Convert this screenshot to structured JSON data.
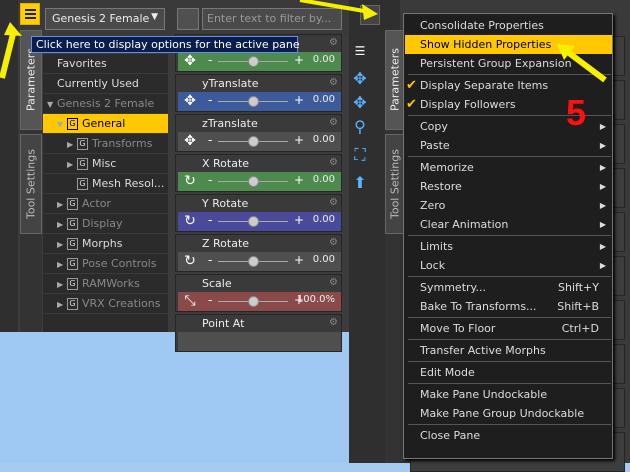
{
  "left_panel": {
    "figure_selector": "Genesis 2 Female",
    "search_placeholder": "Enter text to filter by...",
    "tooltip": "Click here to display options for the active pane",
    "vtabs": [
      "Parameters",
      "Tool Settings"
    ],
    "tree": [
      {
        "label": "Favorites",
        "level": 0,
        "dim": false,
        "sel": false,
        "box": false,
        "arrow": ""
      },
      {
        "label": "Currently Used",
        "level": 0,
        "dim": false,
        "sel": false,
        "box": false,
        "arrow": ""
      },
      {
        "label": "Genesis 2 Female",
        "level": 0,
        "dim": true,
        "sel": false,
        "box": false,
        "arrow": "▼"
      },
      {
        "label": "General",
        "level": 1,
        "dim": false,
        "sel": true,
        "box": true,
        "arrow": "▼"
      },
      {
        "label": "Transforms",
        "level": 2,
        "dim": true,
        "sel": false,
        "box": true,
        "arrow": "▶"
      },
      {
        "label": "Misc",
        "level": 2,
        "dim": false,
        "sel": false,
        "box": true,
        "arrow": "▶"
      },
      {
        "label": "Mesh Resol...",
        "level": 2,
        "dim": false,
        "sel": false,
        "box": true,
        "arrow": ""
      },
      {
        "label": "Actor",
        "level": 1,
        "dim": true,
        "sel": false,
        "box": true,
        "arrow": "▶"
      },
      {
        "label": "Display",
        "level": 1,
        "dim": true,
        "sel": false,
        "box": true,
        "arrow": "▶"
      },
      {
        "label": "Morphs",
        "level": 1,
        "dim": false,
        "sel": false,
        "box": true,
        "arrow": "▶"
      },
      {
        "label": "Pose Controls",
        "level": 1,
        "dim": true,
        "sel": false,
        "box": true,
        "arrow": "▶"
      },
      {
        "label": "RAMWorks",
        "level": 1,
        "dim": true,
        "sel": false,
        "box": true,
        "arrow": "▶"
      },
      {
        "label": "VRX Creations",
        "level": 1,
        "dim": true,
        "sel": false,
        "box": true,
        "arrow": "▶"
      }
    ],
    "params": [
      {
        "name": "",
        "value": "0.00",
        "color": "#4d8a4d",
        "icon": "✥"
      },
      {
        "name": "yTranslate",
        "value": "0.00",
        "color": "#3d5a9a",
        "icon": "✥"
      },
      {
        "name": "zTranslate",
        "value": "0.00",
        "color": "#4f4f4f",
        "icon": "✥"
      },
      {
        "name": "X Rotate",
        "value": "0.00",
        "color": "#4d8a4d",
        "icon": "↻"
      },
      {
        "name": "Y Rotate",
        "value": "0.00",
        "color": "#4a4a9a",
        "icon": "↻"
      },
      {
        "name": "Z Rotate",
        "value": "0.00",
        "color": "#4f4f4f",
        "icon": "↻"
      },
      {
        "name": "Scale",
        "value": "100.0%",
        "color": "#8a4a4a",
        "icon": "⤡"
      },
      {
        "name": "Point At",
        "value": "",
        "color": "#4f4f4f",
        "icon": ""
      }
    ]
  },
  "right_panel": {
    "vtabs": [
      "Parameters",
      "Tool Settings"
    ],
    "annotation_number": "5",
    "menu": [
      {
        "label": "Consolidate Properties",
        "shortcut": "",
        "sub": false,
        "check": false,
        "hl": false
      },
      {
        "label": "Show Hidden Properties",
        "shortcut": "",
        "sub": false,
        "check": false,
        "hl": true
      },
      {
        "label": "Persistent Group Expansion",
        "shortcut": "",
        "sub": false,
        "check": false,
        "hl": false
      },
      {
        "sep": true
      },
      {
        "label": "Display Separate Items",
        "shortcut": "",
        "sub": false,
        "check": true,
        "hl": false
      },
      {
        "label": "Display Followers",
        "shortcut": "",
        "sub": false,
        "check": true,
        "hl": false
      },
      {
        "sep": true
      },
      {
        "label": "Copy",
        "shortcut": "",
        "sub": true,
        "check": false,
        "hl": false
      },
      {
        "label": "Paste",
        "shortcut": "",
        "sub": true,
        "check": false,
        "hl": false
      },
      {
        "sep": true
      },
      {
        "label": "Memorize",
        "shortcut": "",
        "sub": true,
        "check": false,
        "hl": false
      },
      {
        "label": "Restore",
        "shortcut": "",
        "sub": true,
        "check": false,
        "hl": false
      },
      {
        "label": "Zero",
        "shortcut": "",
        "sub": true,
        "check": false,
        "hl": false
      },
      {
        "label": "Clear Animation",
        "shortcut": "",
        "sub": true,
        "check": false,
        "hl": false
      },
      {
        "sep": true
      },
      {
        "label": "Limits",
        "shortcut": "",
        "sub": true,
        "check": false,
        "hl": false
      },
      {
        "label": "Lock",
        "shortcut": "",
        "sub": true,
        "check": false,
        "hl": false
      },
      {
        "sep": true
      },
      {
        "label": "Symmetry...",
        "shortcut": "Shift+Y",
        "sub": false,
        "check": false,
        "hl": false
      },
      {
        "label": "Bake To Transforms...",
        "shortcut": "Shift+B",
        "sub": false,
        "check": false,
        "hl": false
      },
      {
        "sep": true
      },
      {
        "label": "Move To Floor",
        "shortcut": "Ctrl+D",
        "sub": false,
        "check": false,
        "hl": false
      },
      {
        "sep": true
      },
      {
        "label": "Transfer Active Morphs",
        "shortcut": "",
        "sub": false,
        "check": false,
        "hl": false
      },
      {
        "sep": true
      },
      {
        "label": "Edit Mode",
        "shortcut": "",
        "sub": false,
        "check": false,
        "hl": false
      },
      {
        "sep": true
      },
      {
        "label": "Make Pane Undockable",
        "shortcut": "",
        "sub": false,
        "check": false,
        "hl": false
      },
      {
        "label": "Make Pane Group Undockable",
        "shortcut": "",
        "sub": false,
        "check": false,
        "hl": false
      },
      {
        "sep": true
      },
      {
        "label": "Close Pane",
        "shortcut": "",
        "sub": false,
        "check": false,
        "hl": false
      }
    ]
  },
  "colors": {
    "highlight": "#ffc800",
    "arrow": "#f5f000",
    "annotation": "#ff1010"
  }
}
